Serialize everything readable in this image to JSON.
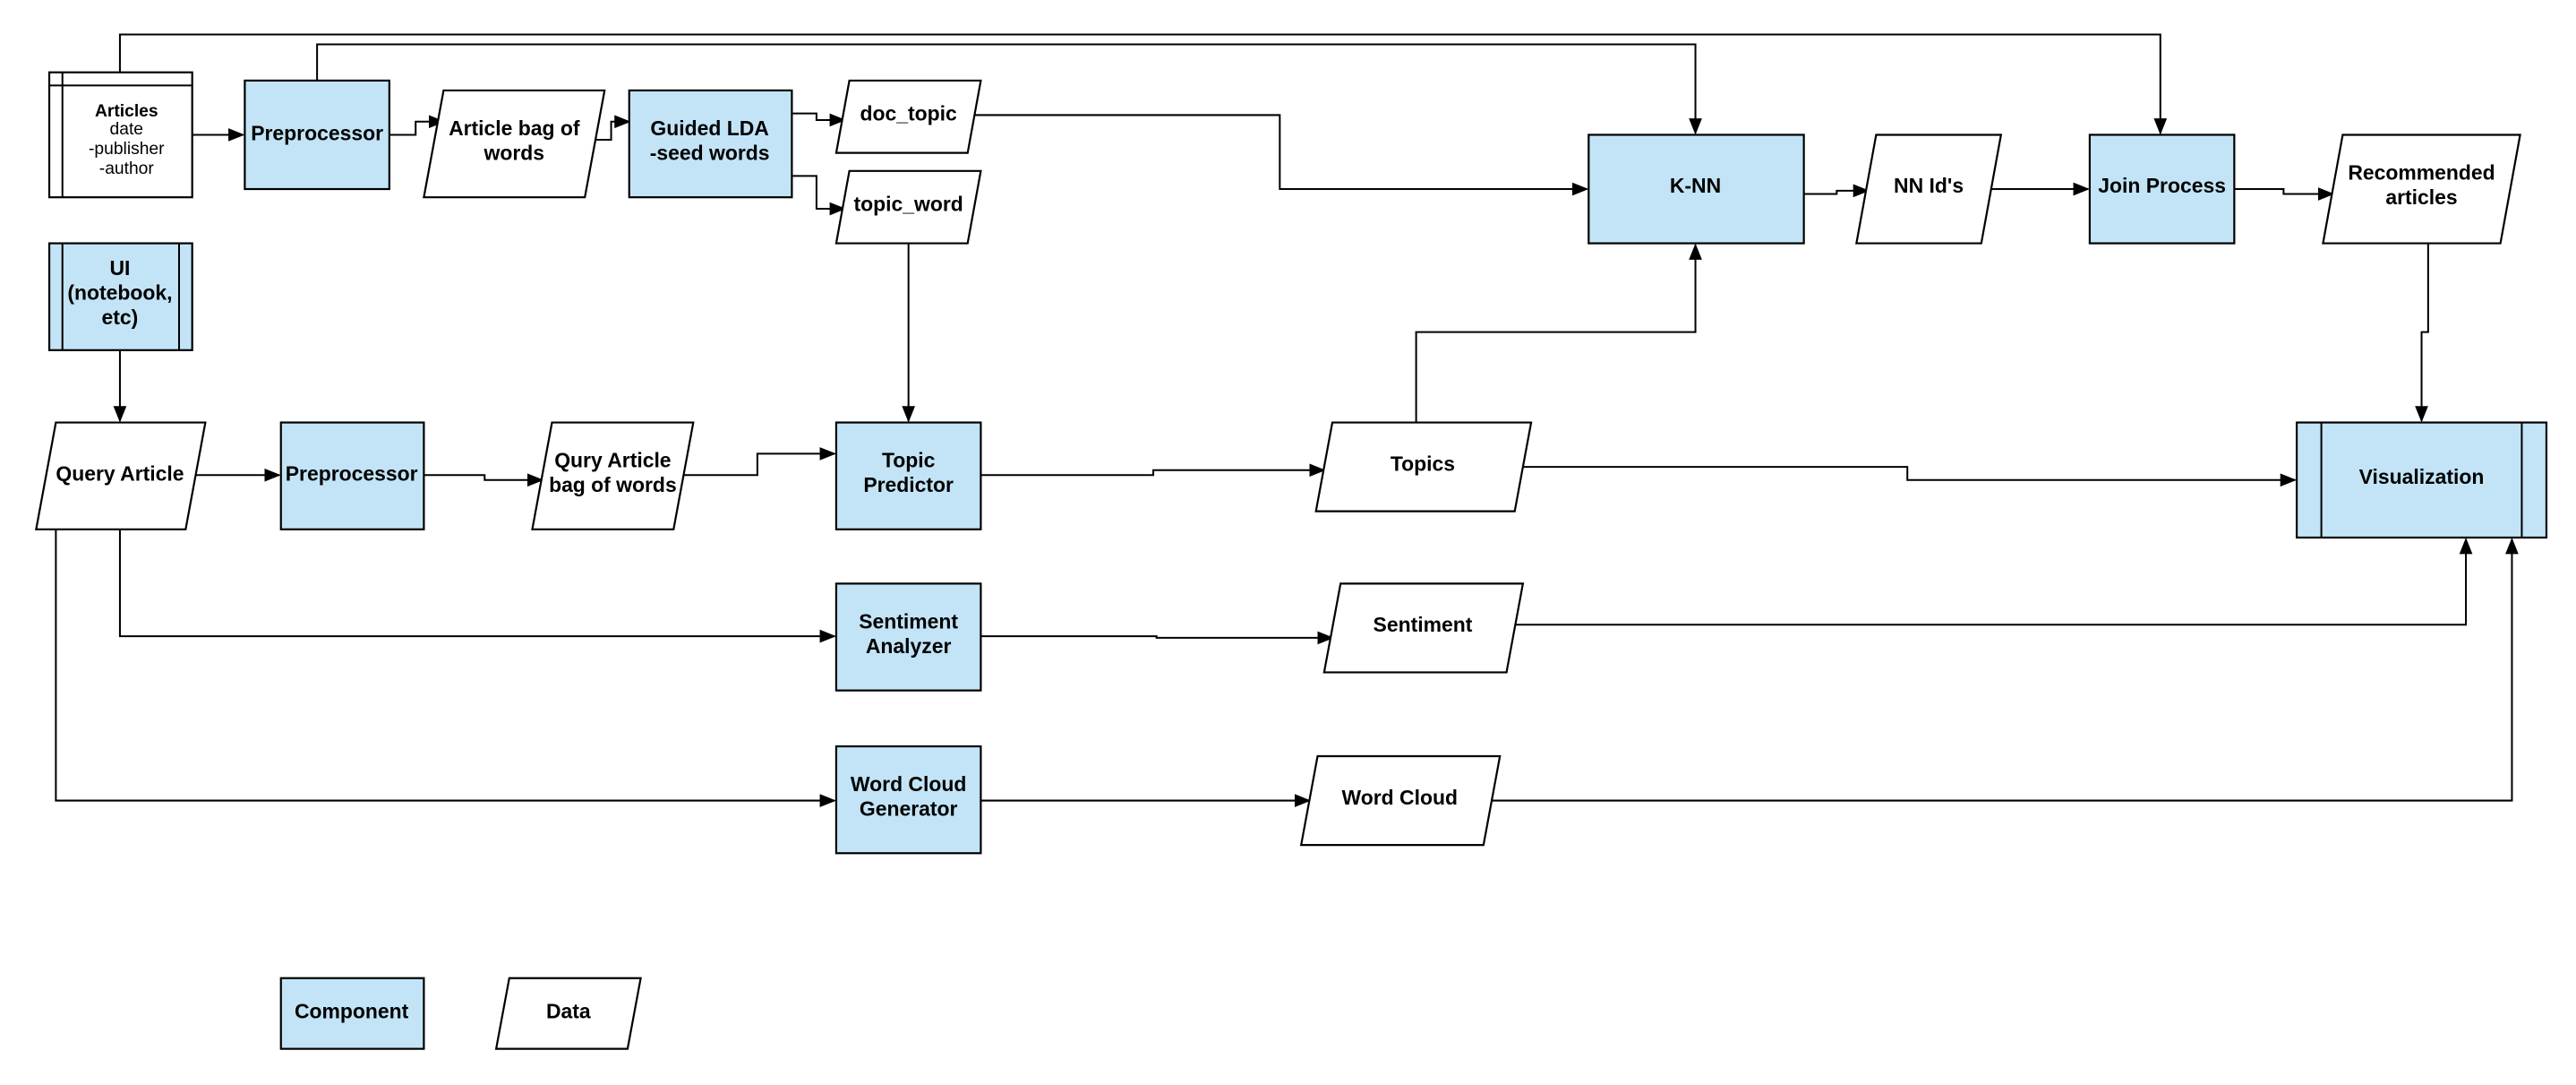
{
  "colors": {
    "component_fill": "#c2e4f6",
    "data_fill": "#ffffff",
    "stroke": "#000000"
  },
  "nodes": {
    "articles": {
      "title": "Articles",
      "fields": [
        "date",
        "-publisher",
        "-author"
      ]
    },
    "preprocessor_1": {
      "lines": [
        "Preprocessor"
      ]
    },
    "article_bag": {
      "lines": [
        "Article bag of",
        "words"
      ]
    },
    "guided_lda": {
      "lines": [
        "Guided LDA",
        "-seed words"
      ]
    },
    "doc_topic": {
      "lines": [
        "doc_topic"
      ]
    },
    "topic_word": {
      "lines": [
        "topic_word"
      ]
    },
    "knn": {
      "lines": [
        "K-NN"
      ]
    },
    "nn_ids": {
      "lines": [
        "NN Id's"
      ]
    },
    "join_process": {
      "lines": [
        "Join Process"
      ]
    },
    "recommended": {
      "lines": [
        "Recommended",
        "articles"
      ]
    },
    "ui": {
      "lines": [
        "UI",
        "(notebook,",
        "etc)"
      ]
    },
    "query_article": {
      "lines": [
        "Query Article"
      ]
    },
    "preprocessor_2": {
      "lines": [
        "Preprocessor"
      ]
    },
    "query_bag": {
      "lines": [
        "Qury Article",
        "bag of words"
      ]
    },
    "topic_predictor": {
      "lines": [
        "Topic",
        "Predictor"
      ]
    },
    "topics": {
      "lines": [
        "Topics"
      ]
    },
    "visualization": {
      "lines": [
        "Visualization"
      ]
    },
    "sentiment_analyzer": {
      "lines": [
        "Sentiment",
        "Analyzer"
      ]
    },
    "sentiment": {
      "lines": [
        "Sentiment"
      ]
    },
    "word_cloud_generator": {
      "lines": [
        "Word Cloud",
        "Generator"
      ]
    },
    "word_cloud": {
      "lines": [
        "Word Cloud"
      ]
    }
  },
  "legend": {
    "component": "Component",
    "data": "Data"
  }
}
